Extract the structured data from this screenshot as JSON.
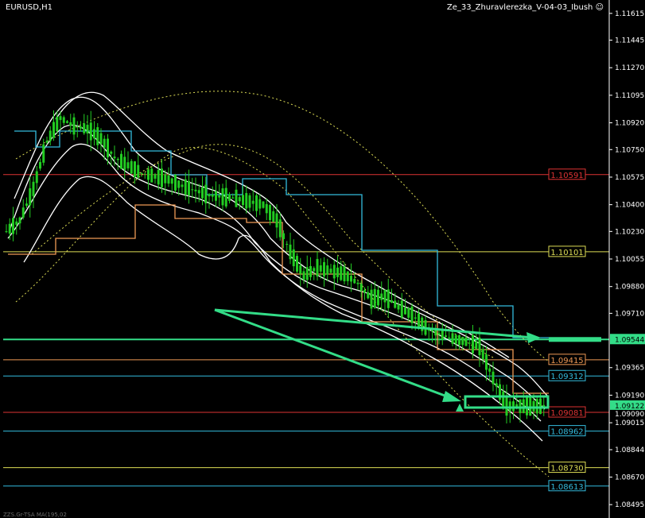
{
  "window": {
    "symbol_label": "EURUSD,H1",
    "indicator_label": "Ze_33_Zhuravlerezka_V-04-03_Ibush",
    "indicator_icon": "smiley-icon",
    "status_text": "ZZS.Gr-TSA MA(195,02"
  },
  "colors": {
    "background": "#000000",
    "axis": "#ffffff",
    "candles": "#22cc22",
    "trend_arrow": "#33dd88",
    "envelope_band": "#ffffff",
    "step_line_blue": "#33bbdd",
    "step_line_orange": "#ee9955",
    "dotted_envelope": "#dddd55"
  },
  "axis": {
    "prices": [
      "1.11615",
      "1.11445",
      "1.11270",
      "1.11095",
      "1.10920",
      "1.10750",
      "1.10575",
      "1.10400",
      "1.10230",
      "1.10055",
      "1.09880",
      "1.09710",
      "1.09365",
      "1.09190",
      "1.09015",
      "1.08844",
      "1.08670",
      "1.08495"
    ],
    "current_price": "1.09544",
    "extra_price_top": "1.09122",
    "extra_price_bottom": "1.09090"
  },
  "levels": [
    {
      "value": "1.10591",
      "color": "#dd3333",
      "text_color": "#dd3333"
    },
    {
      "value": "1.10101",
      "color": "#dddd55",
      "text_color": "#dddd55"
    },
    {
      "value": "1.09544",
      "color": "#33dd88",
      "text_color": "#000000"
    },
    {
      "value": "1.09415",
      "color": "#ee9955",
      "text_color": "#ee9955"
    },
    {
      "value": "1.09312",
      "color": "#33bbdd",
      "text_color": "#33bbdd"
    },
    {
      "value": "1.09081",
      "color": "#dd3333",
      "text_color": "#dd3333"
    },
    {
      "value": "1.08962",
      "color": "#33bbdd",
      "text_color": "#33bbdd"
    },
    {
      "value": "1.08730",
      "color": "#dddd55",
      "text_color": "#dddd55"
    },
    {
      "value": "1.08613",
      "color": "#33bbdd",
      "text_color": "#33bbdd"
    }
  ],
  "chart_data": {
    "type": "candlestick",
    "symbol": "EURUSD",
    "timeframe": "H1",
    "ylim": [
      1.0841,
      1.117
    ],
    "closes": [
      1.1023,
      1.103,
      1.105,
      1.108,
      1.1095,
      1.109,
      1.1088,
      1.1082,
      1.107,
      1.1065,
      1.106,
      1.1058,
      1.1056,
      1.1052,
      1.1049,
      1.1046,
      1.1045,
      1.1044,
      1.1042,
      1.104,
      1.103,
      1.101,
      1.0995,
      1.1,
      1.0998,
      1.0996,
      1.099,
      1.098,
      1.0982,
      1.0975,
      1.097,
      1.0962,
      1.0958,
      1.0955,
      1.0953,
      1.095,
      1.093,
      1.0912,
      1.0912,
      1.0912,
      1.0912
    ]
  }
}
